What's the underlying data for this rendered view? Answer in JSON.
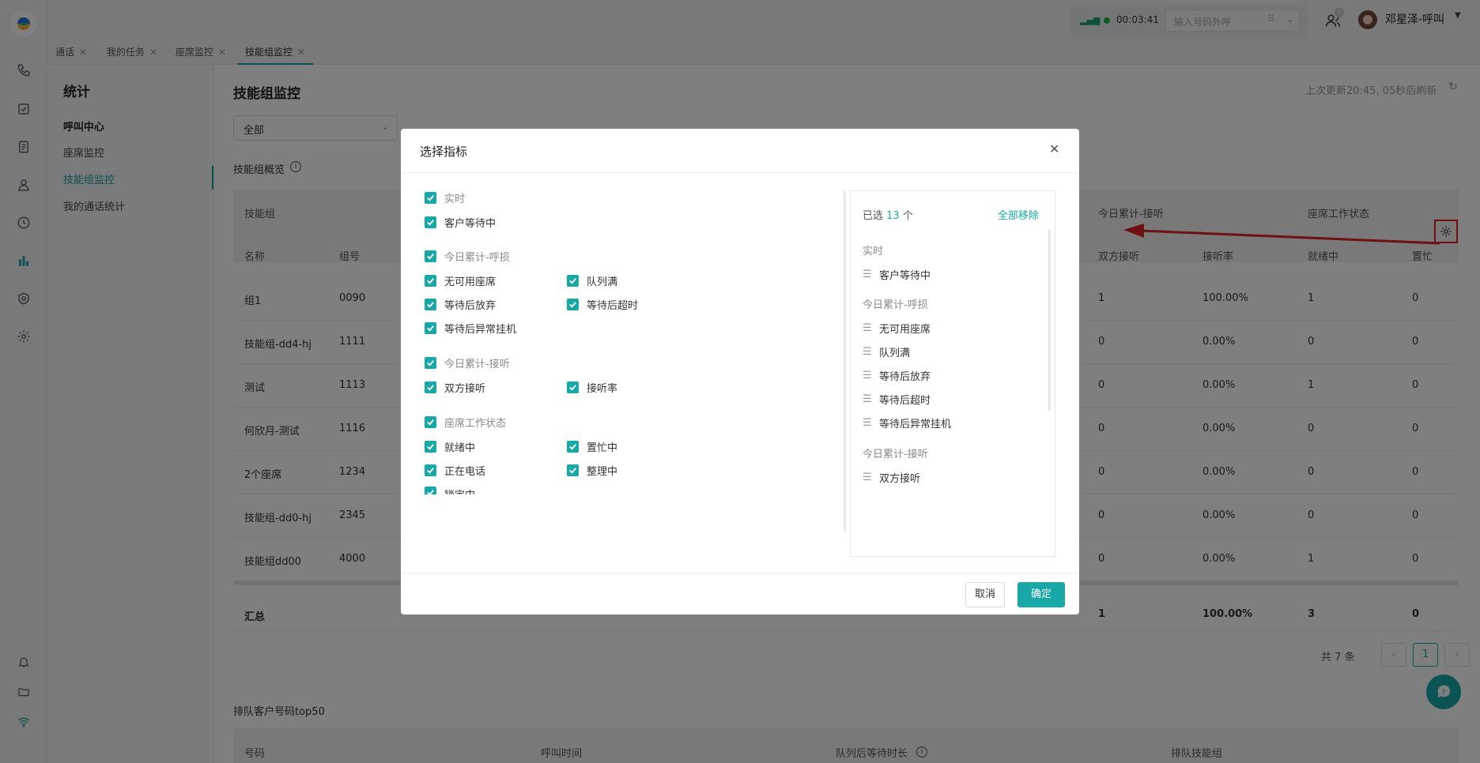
{
  "topbar": {
    "timer": "00:03:41",
    "dial_placeholder": "输入号码外呼",
    "badge": "0",
    "user_name": "邓星泽-呼叫"
  },
  "tabs": [
    {
      "label": "通话"
    },
    {
      "label": "我的任务"
    },
    {
      "label": "座席监控"
    },
    {
      "label": "技能组监控"
    }
  ],
  "subnav": {
    "title": "统计",
    "group": "呼叫中心",
    "items": [
      {
        "label": "座席监控"
      },
      {
        "label": "技能组监控"
      },
      {
        "label": "我的通话统计"
      }
    ]
  },
  "page": {
    "title": "技能组监控",
    "refresh_text": "上次更新20:45, 05秒后刷新",
    "filter_value": "全部",
    "overview_label": "技能组概览",
    "table": {
      "group_header": "技能组",
      "col_name": "名称",
      "col_id": "组号",
      "group_header2": "今日累计-接听",
      "group_header3": "座席工作状态",
      "col_both": "双方接听",
      "col_rate": "接听率",
      "col_ready": "就绪中",
      "col_busy": "置忙",
      "rows": [
        {
          "name": "组1",
          "id": "0090",
          "both": "1",
          "rate": "100.00%",
          "ready": "1",
          "busy": "0"
        },
        {
          "name": "技能组-dd4-hj",
          "id": "1111",
          "both": "0",
          "rate": "0.00%",
          "ready": "0",
          "busy": "0"
        },
        {
          "name": "测试",
          "id": "1113",
          "both": "0",
          "rate": "0.00%",
          "ready": "1",
          "busy": "0"
        },
        {
          "name": "何欣月-测试",
          "id": "1116",
          "both": "0",
          "rate": "0.00%",
          "ready": "0",
          "busy": "0"
        },
        {
          "name": "2个座席",
          "id": "1234",
          "both": "0",
          "rate": "0.00%",
          "ready": "0",
          "busy": "0"
        },
        {
          "name": "技能组-dd0-hj",
          "id": "2345",
          "both": "0",
          "rate": "0.00%",
          "ready": "0",
          "busy": "0"
        },
        {
          "name": "技能组dd00",
          "id": "4000",
          "both": "0",
          "rate": "0.00%",
          "ready": "1",
          "busy": "0"
        }
      ],
      "total_label": "汇总",
      "total_both": "1",
      "total_rate": "100.00%",
      "total_ready": "3",
      "total_busy": "0"
    },
    "pagination": {
      "total": "共 7 条",
      "page": "1"
    },
    "queue_title": "排队客户号码top50",
    "queue_cols": [
      "号码",
      "呼叫时间",
      "队列后等待时长",
      "排队技能组"
    ]
  },
  "modal": {
    "title": "选择指标",
    "groups": [
      {
        "label": "实时",
        "items": [
          "客户等待中"
        ]
      },
      {
        "label": "今日累计-呼损",
        "items": [
          "无可用座席",
          "队列满",
          "等待后放弃",
          "等待后超时",
          "等待后异常挂机"
        ]
      },
      {
        "label": "今日累计-接听",
        "items": [
          "双方接听",
          "接听率"
        ]
      },
      {
        "label": "座席工作状态",
        "items": [
          "就绪中",
          "置忙中",
          "正在电话",
          "整理中",
          "锁定中"
        ]
      }
    ],
    "selected_prefix": "已选",
    "selected_count": "13",
    "selected_suffix": "个",
    "remove_all": "全部移除",
    "selected_groups": [
      {
        "label": "实时",
        "items": [
          "客户等待中"
        ]
      },
      {
        "label": "今日累计-呼损",
        "items": [
          "无可用座席",
          "队列满",
          "等待后放弃",
          "等待后超时",
          "等待后异常挂机"
        ]
      },
      {
        "label": "今日累计-接听",
        "items": [
          "双方接听"
        ]
      }
    ],
    "cancel": "取消",
    "confirm": "确定"
  },
  "colors": {
    "accent": "#18a8a8",
    "highlight": "#e02020"
  }
}
